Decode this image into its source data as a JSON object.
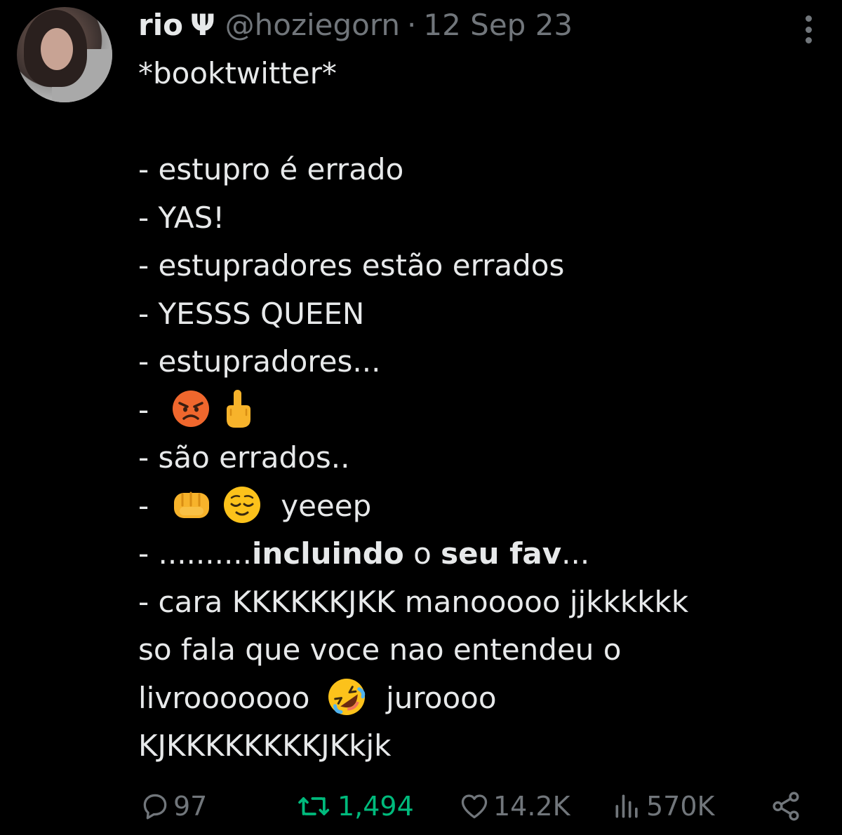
{
  "author": {
    "display_name": "rio",
    "name_symbol": "Ψ",
    "handle": "@hoziegorn",
    "separator": "·",
    "date": "12 Sep 23"
  },
  "tweet": {
    "lines": [
      "*booktwitter*",
      "",
      "- estupro é errado",
      "- YAS!",
      "- estupradores estão errados",
      "- YESSS QUEEN",
      "- estupradores...",
      "-",
      "- são errados..",
      "-",
      "- ..........",
      "- cara KKKKKKJKK manooooo jjkkkkkk",
      "so fala que voce nao entendeu o",
      "livrooooooo",
      "KJKKKKKKKKJKkjk"
    ],
    "line10_text": "yeeep",
    "line11_bold1": "incluindo",
    "line11_mid": " o ",
    "line11_bold2": "seu fav",
    "line11_end": "...",
    "line14_end": "juroooo",
    "emojis": [
      "angry-face",
      "middle-finger",
      "oncoming-fist",
      "relieved-face",
      "rolling-on-floor-laughing"
    ]
  },
  "actions": {
    "replies": "97",
    "retweets": "1,494",
    "likes": "14.2K",
    "views": "570K"
  },
  "colors": {
    "background": "#000000",
    "text": "#e7e9ea",
    "secondary": "#71767b",
    "retweet_green": "#00ba7c"
  }
}
